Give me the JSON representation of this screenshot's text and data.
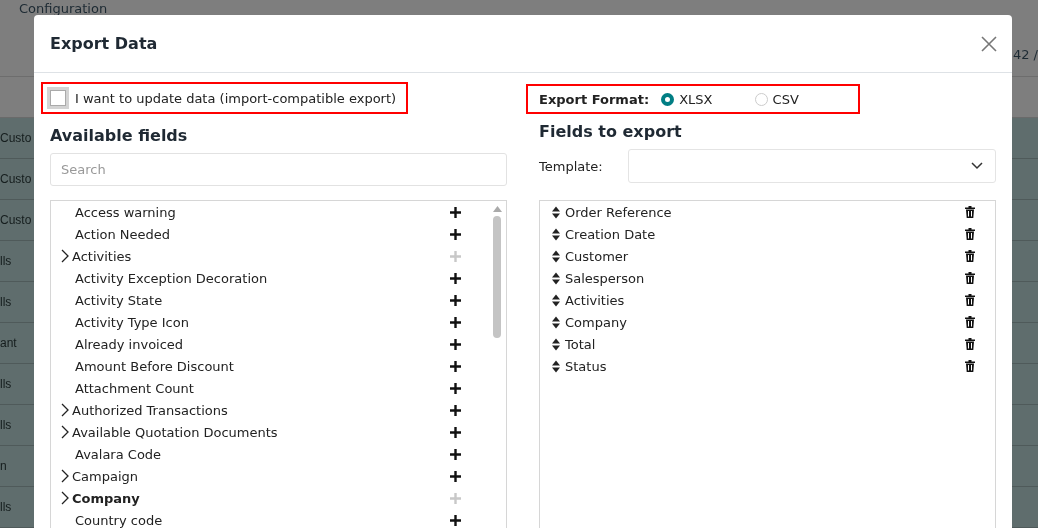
{
  "background": {
    "heading": "Configuration",
    "pager": "42 /",
    "rows": [
      "Custo",
      "Custo",
      "Custo",
      "lls",
      "lls",
      "ant",
      "lls",
      "lls",
      "n",
      "lls"
    ]
  },
  "dialog": {
    "title": "Export Data",
    "import_compatible": {
      "label": "I want to update data (import-compatible export)",
      "checked": false,
      "highlighted": true
    },
    "export_format": {
      "label": "Export Format:",
      "highlighted": true,
      "options": [
        {
          "label": "XLSX",
          "selected": true
        },
        {
          "label": "CSV",
          "selected": false
        }
      ]
    },
    "available_fields": {
      "heading": "Available fields",
      "search": {
        "placeholder": "Search"
      },
      "items": [
        {
          "label": "Access warning",
          "expandable": false,
          "bold": false,
          "add_disabled": false
        },
        {
          "label": "Action Needed",
          "expandable": false,
          "bold": false,
          "add_disabled": false
        },
        {
          "label": "Activities",
          "expandable": true,
          "bold": false,
          "add_disabled": true
        },
        {
          "label": "Activity Exception Decoration",
          "expandable": false,
          "bold": false,
          "add_disabled": false
        },
        {
          "label": "Activity State",
          "expandable": false,
          "bold": false,
          "add_disabled": false
        },
        {
          "label": "Activity Type Icon",
          "expandable": false,
          "bold": false,
          "add_disabled": false
        },
        {
          "label": "Already invoiced",
          "expandable": false,
          "bold": false,
          "add_disabled": false
        },
        {
          "label": "Amount Before Discount",
          "expandable": false,
          "bold": false,
          "add_disabled": false
        },
        {
          "label": "Attachment Count",
          "expandable": false,
          "bold": false,
          "add_disabled": false
        },
        {
          "label": "Authorized Transactions",
          "expandable": true,
          "bold": false,
          "add_disabled": false
        },
        {
          "label": "Available Quotation Documents",
          "expandable": true,
          "bold": false,
          "add_disabled": false
        },
        {
          "label": "Avalara Code",
          "expandable": false,
          "bold": false,
          "add_disabled": false
        },
        {
          "label": "Campaign",
          "expandable": true,
          "bold": false,
          "add_disabled": false
        },
        {
          "label": "Company",
          "expandable": true,
          "bold": true,
          "add_disabled": true
        },
        {
          "label": "Country code",
          "expandable": false,
          "bold": false,
          "add_disabled": false
        }
      ]
    },
    "fields_to_export": {
      "heading": "Fields to export",
      "template_label": "Template:",
      "items": [
        "Order Reference",
        "Creation Date",
        "Customer",
        "Salesperson",
        "Activities",
        "Company",
        "Total",
        "Status"
      ]
    }
  }
}
